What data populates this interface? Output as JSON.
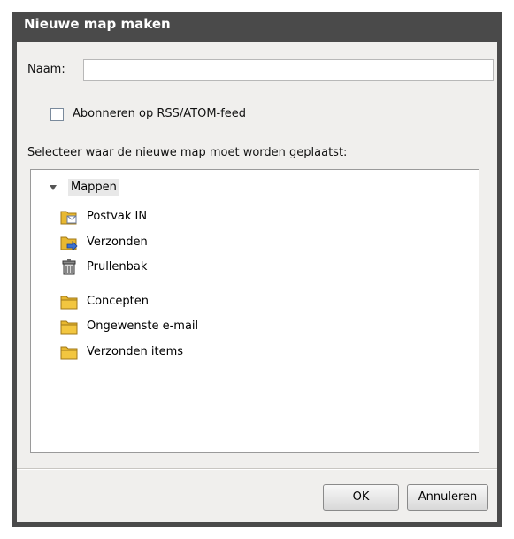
{
  "dialog": {
    "title": "Nieuwe map maken",
    "name_label": "Naam:",
    "name_value": "",
    "subscribe_label": "Abonneren op RSS/ATOM-feed",
    "subscribe_checked": false,
    "location_label": "Selecteer waar de nieuwe map moet worden geplaatst:",
    "ok_label": "OK",
    "cancel_label": "Annuleren"
  },
  "tree": {
    "root_label": "Mappen",
    "root_expanded": true,
    "items": [
      {
        "label": "Postvak IN",
        "icon": "inbox-folder-icon"
      },
      {
        "label": "Verzonden",
        "icon": "sent-folder-icon"
      },
      {
        "label": "Prullenbak",
        "icon": "trash-icon"
      },
      {
        "label": "Concepten",
        "icon": "folder-icon"
      },
      {
        "label": "Ongewenste e-mail",
        "icon": "folder-icon"
      },
      {
        "label": "Verzonden items",
        "icon": "folder-icon"
      }
    ]
  },
  "colors": {
    "titlebar": "#4a4a4a",
    "panel": "#f0efed",
    "folder": "#e8b830"
  }
}
